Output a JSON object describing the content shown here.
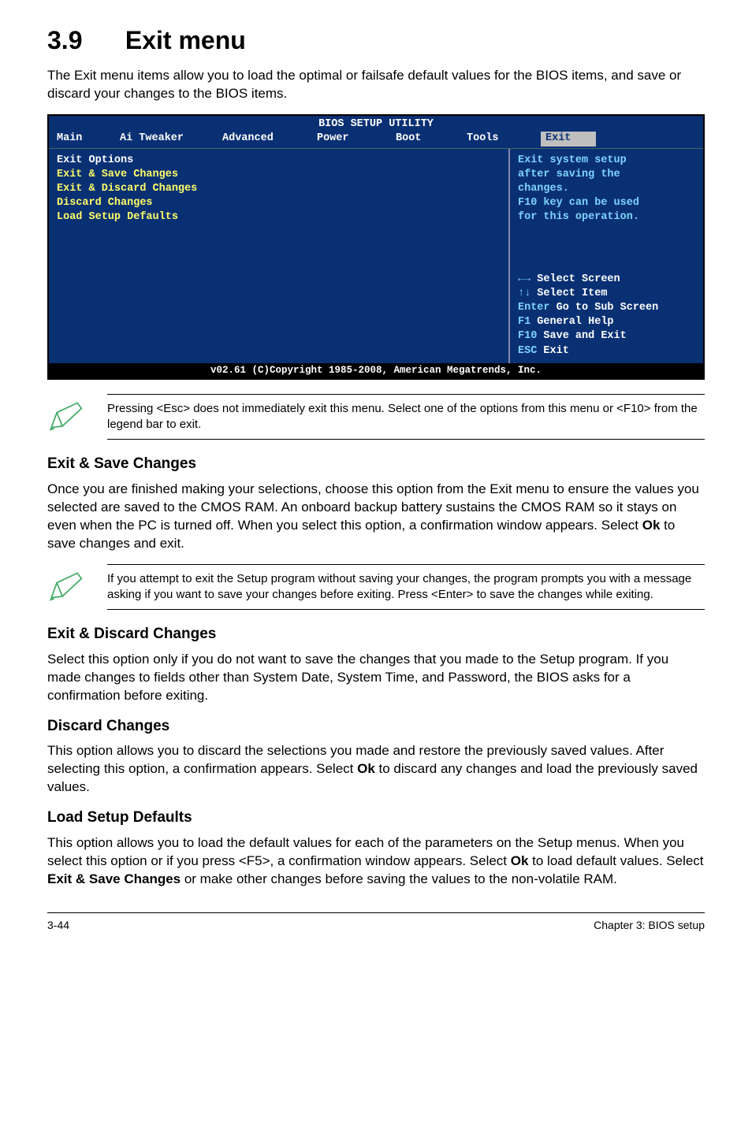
{
  "section": {
    "number": "3.9",
    "title": "Exit menu"
  },
  "intro": "The Exit menu items allow you to load the optimal or failsafe default values for the BIOS items, and save or discard your changes to the BIOS items.",
  "bios": {
    "title": "BIOS SETUP UTILITY",
    "tabs": {
      "main": "Main",
      "tweak": "Ai Tweaker",
      "adv": "Advanced",
      "power": "Power",
      "boot": "Boot",
      "tools": "Tools",
      "exit": "Exit"
    },
    "left": {
      "head": "Exit Options",
      "lines": [
        "Exit & Save Changes",
        "Exit & Discard Changes",
        "Discard Changes",
        "",
        "Load Setup Defaults"
      ]
    },
    "right": {
      "help1": "Exit system setup",
      "help2": "after saving the",
      "help3": "changes.",
      "help4": "",
      "help5": "F10 key can be used",
      "help6": "for this operation.",
      "k1a": "←→",
      "k1b": "   Select Screen",
      "k2a": "↑↓",
      "k2b": "   Select Item",
      "k3a": "Enter",
      "k3b": " Go to Sub Screen",
      "k4a": "F1",
      "k4b": "   General Help",
      "k5a": "F10",
      "k5b": "  Save and Exit",
      "k6a": "ESC",
      "k6b": "  Exit"
    },
    "copy": "v02.61 (C)Copyright 1985-2008, American Megatrends, Inc."
  },
  "note1": "Pressing <Esc> does not immediately exit this menu. Select one of the options from this menu or <F10> from the legend bar to exit.",
  "s1": {
    "title": "Exit & Save Changes",
    "p1a": "Once you are finished making your selections, choose this option from the Exit menu to ensure the values you selected are saved to the CMOS RAM. An onboard backup battery sustains the CMOS RAM so it stays on even when the PC is turned off. When you select this option, a confirmation window appears. Select ",
    "p1b": "Ok",
    "p1c": " to save changes and exit."
  },
  "note2": "If you attempt to exit the Setup program without saving your changes, the program prompts you with a message asking if you want to save your changes before exiting. Press <Enter> to save the changes while exiting.",
  "s2": {
    "title": "Exit & Discard Changes",
    "p": "Select this option only if you do not want to save the changes that you  made to the Setup program. If you made changes to fields other than System Date, System Time, and Password, the BIOS asks for a confirmation before exiting."
  },
  "s3": {
    "title": "Discard Changes",
    "p1a": "This option allows you to discard the selections you made and restore the previously saved values. After selecting this option, a confirmation appears. Select ",
    "p1b": "Ok",
    "p1c": " to discard any changes and load the previously saved values."
  },
  "s4": {
    "title": "Load Setup Defaults",
    "p1a": "This option allows you to load the default values for each of the parameters on the Setup menus. When you select this option or if you press <F5>, a confirmation window appears. Select ",
    "p1b": "Ok",
    "p1c": " to load default values. Select ",
    "p1d": "Exit & Save Changes",
    "p1e": " or make other changes before saving the values to the non-volatile RAM."
  },
  "footer": {
    "left": "3-44",
    "right": "Chapter 3: BIOS setup"
  }
}
